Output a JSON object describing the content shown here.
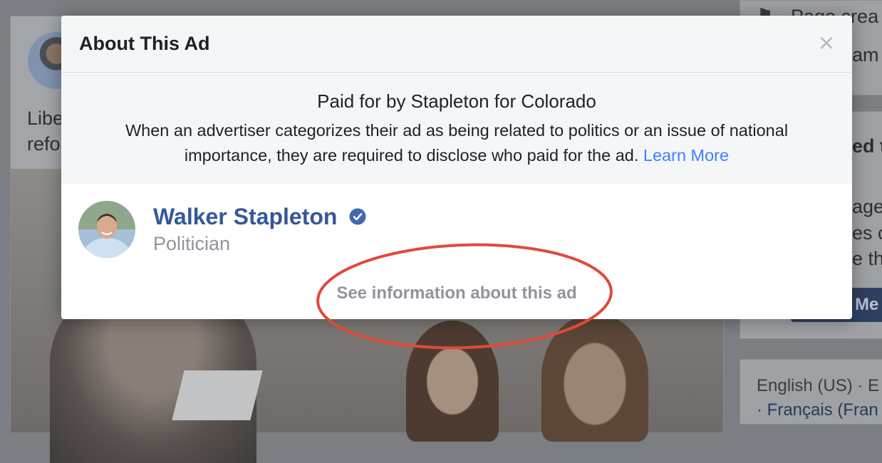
{
  "background": {
    "post_text_lines": [
      "Libe",
      "refo"
    ],
    "sidebar_lines": [
      "Page crea",
      "am",
      "ed t",
      "age",
      "es c",
      "e th"
    ],
    "sidebar_button": "Me",
    "footer_lines": [
      "English (US) · E",
      "· Français (Fran"
    ]
  },
  "modal": {
    "title": "About This Ad",
    "close_icon": "close-icon",
    "paid_for": "Paid for by Stapleton for Colorado",
    "disclaimer": "When an advertiser categorizes their ad as being related to politics or an issue of national importance, they are required to disclose who paid for the ad.",
    "learn_more": "Learn More",
    "profile": {
      "name": "Walker Stapleton",
      "role": "Politician",
      "verified_icon": "verified-badge-icon"
    },
    "see_info_link": "See information about this ad"
  },
  "colors": {
    "link_blue": "#4080ff",
    "name_blue": "#365899",
    "verified_blue": "#4267b2",
    "annotation_red": "#e04a3a",
    "muted_gray": "#90949c"
  }
}
